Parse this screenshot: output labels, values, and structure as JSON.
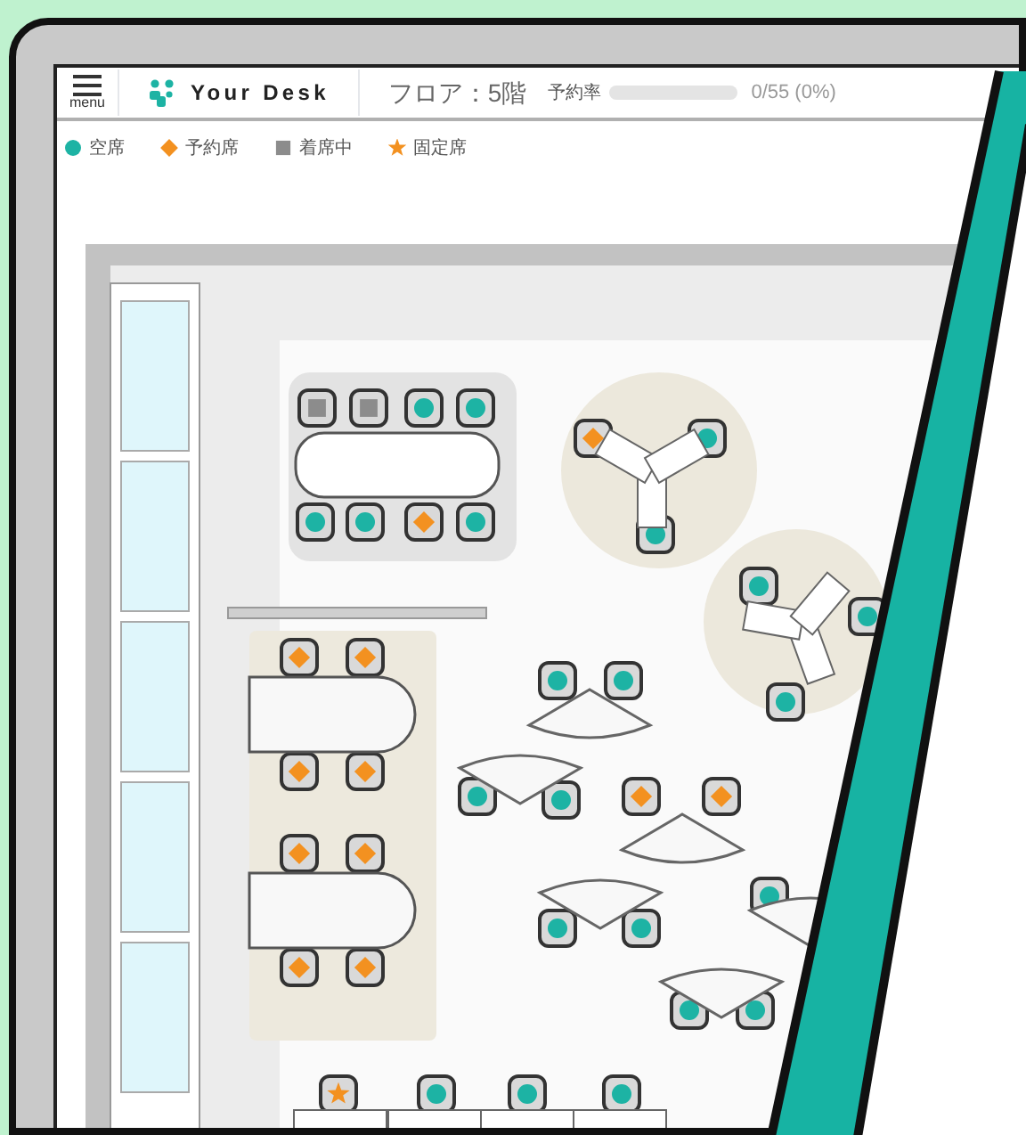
{
  "header": {
    "menu_label": "menu",
    "brand": "Your Desk",
    "floor": "フロア：5階",
    "rate_label": "予約率",
    "rate": {
      "level": 0
    },
    "rate_text": "0/55 (0%)"
  },
  "legend": [
    {
      "label": "空席",
      "kind": "vacant"
    },
    {
      "label": "予約席",
      "kind": "reserved"
    },
    {
      "label": "着席中",
      "kind": "occupied"
    },
    {
      "label": "固定席",
      "kind": "fixed"
    }
  ],
  "seats": [
    {
      "kind": "occupied"
    },
    {
      "kind": "occupied"
    },
    {
      "kind": "vacant"
    },
    {
      "kind": "vacant"
    },
    {
      "kind": "vacant"
    },
    {
      "kind": "vacant"
    },
    {
      "kind": "reserved"
    },
    {
      "kind": "vacant"
    },
    {
      "kind": "reserved"
    },
    {
      "kind": "vacant"
    },
    {
      "kind": "vacant"
    },
    {
      "kind": "vacant"
    },
    {
      "kind": "vacant"
    },
    {
      "kind": "vacant"
    },
    {
      "kind": "reserved"
    },
    {
      "kind": "reserved"
    },
    {
      "kind": "reserved"
    },
    {
      "kind": "reserved"
    },
    {
      "kind": "reserved"
    },
    {
      "kind": "reserved"
    },
    {
      "kind": "reserved"
    },
    {
      "kind": "reserved"
    },
    {
      "kind": "vacant"
    },
    {
      "kind": "vacant"
    },
    {
      "kind": "vacant"
    },
    {
      "kind": "vacant"
    },
    {
      "kind": "reserved"
    },
    {
      "kind": "reserved"
    },
    {
      "kind": "vacant"
    },
    {
      "kind": "vacant"
    },
    {
      "kind": "vacant"
    },
    {
      "kind": "vacant"
    },
    {
      "kind": "vacant"
    },
    {
      "kind": "fixed"
    },
    {
      "kind": "vacant"
    },
    {
      "kind": "vacant"
    },
    {
      "kind": "vacant"
    }
  ]
}
